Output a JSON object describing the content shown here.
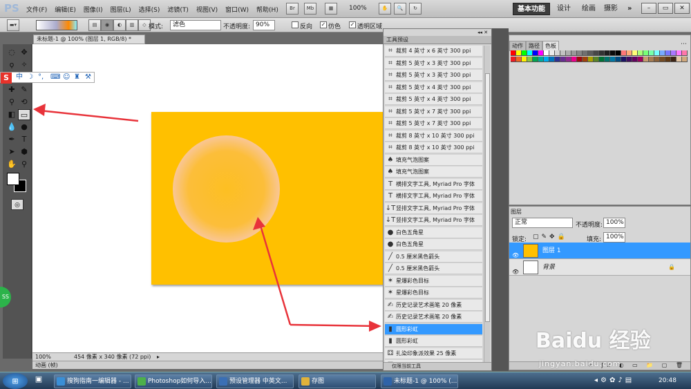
{
  "app": {
    "logo": "PS",
    "doc_tab": "未标题-1 @ 100% (图层 1, RGB/8) *"
  },
  "menus": [
    "文件(F)",
    "编辑(E)",
    "图像(I)",
    "图层(L)",
    "选择(S)",
    "滤镜(T)",
    "视图(V)",
    "窗口(W)",
    "帮助(H)"
  ],
  "toolbar": {
    "btn_br": "Br",
    "btn_mb": "Mb",
    "zoom": "100%"
  },
  "workspaces": [
    "基本功能",
    "设计",
    "绘画",
    "摄影"
  ],
  "window_controls": [
    "–",
    "▭",
    "✕"
  ],
  "options": {
    "mode_label": "模式:",
    "mode_value": "滤色",
    "opacity_label": "不透明度:",
    "opacity_value": "90%",
    "reverse_label": "反向",
    "dither_label": "仿色",
    "transparency_label": "透明区域"
  },
  "status": {
    "zoom": "100%",
    "info": "454 像素 x 340 像素 (72 ppi)",
    "anim_label": "动画 (帧)"
  },
  "ime": {
    "logo": "S",
    "mode": "中"
  },
  "badge": {
    "text": "SS"
  },
  "presets": {
    "title": "工具预设",
    "footer": "仅限当前工具",
    "items": [
      {
        "icon": "crop-icon",
        "label": "裁剪 4 英寸 x 6 英寸 300 ppi"
      },
      {
        "icon": "crop-icon",
        "label": "裁剪 5 英寸 x 3 英寸 300 ppi"
      },
      {
        "icon": "crop-icon",
        "label": "裁剪 5 英寸 x 3 英寸 300 ppi"
      },
      {
        "icon": "crop-icon",
        "label": "裁剪 5 英寸 x 4 英寸 300 ppi"
      },
      {
        "icon": "crop-icon",
        "label": "裁剪 5 英寸 x 4 英寸 300 ppi"
      },
      {
        "icon": "crop-icon",
        "label": "裁剪 5 英寸 x 7 英寸 300 ppi"
      },
      {
        "icon": "crop-icon",
        "label": "裁剪 5 英寸 x 7 英寸 300 ppi"
      },
      {
        "icon": "crop-icon",
        "label": "裁剪 8 英寸 x 10 英寸 300 ppi"
      },
      {
        "icon": "crop-icon",
        "label": "裁剪 8 英寸 x 10 英寸 300 ppi"
      },
      {
        "icon": "bucket-icon",
        "label": "填充气泡图案"
      },
      {
        "icon": "bucket-icon",
        "label": "填充气泡图案"
      },
      {
        "icon": "type-icon",
        "label": "横排文字工具, Myriad Pro 字体"
      },
      {
        "icon": "type-icon",
        "label": "横排文字工具, Myriad Pro 字体"
      },
      {
        "icon": "vtype-icon",
        "label": "竖排文字工具, Myriad Pro 字体"
      },
      {
        "icon": "vtype-icon",
        "label": "竖排文字工具, Myriad Pro 字体"
      },
      {
        "icon": "shape-icon",
        "label": "白色五角星"
      },
      {
        "icon": "shape-icon",
        "label": "白色五角星"
      },
      {
        "icon": "line-icon",
        "label": "0.5 厘米黑色箭头"
      },
      {
        "icon": "line-icon",
        "label": "0.5 厘米黑色箭头"
      },
      {
        "icon": "star-icon",
        "label": "星爆彩色目标"
      },
      {
        "icon": "star-icon",
        "label": "星爆彩色目标"
      },
      {
        "icon": "history-brush-icon",
        "label": "历史记录艺术画笔 20 像素"
      },
      {
        "icon": "history-brush-icon",
        "label": "历史记录艺术画笔 20 像素"
      },
      {
        "icon": "gradient-icon",
        "label": "圆形彩虹",
        "selected": true
      },
      {
        "icon": "gradient-icon",
        "label": "圆形彩虹"
      },
      {
        "icon": "stamp-icon",
        "label": "扎染印象派效果 25 像素"
      },
      {
        "icon": "stamp-icon",
        "label": "扎染印象派效果 25 像素"
      }
    ]
  },
  "swatches": {
    "tabs": [
      "动作",
      "路径",
      "色板"
    ],
    "colors": [
      "#ff0000",
      "#ffff00",
      "#00ff00",
      "#00ffff",
      "#0000ff",
      "#ff00ff",
      "#ffffff",
      "#ebebeb",
      "#d6d6d6",
      "#c2c2c2",
      "#adadad",
      "#999999",
      "#858585",
      "#707070",
      "#5c5c5c",
      "#474747",
      "#333333",
      "#1f1f1f",
      "#0a0a0a",
      "#000000",
      "#ff7777",
      "#ffaa77",
      "#ffff77",
      "#aaff77",
      "#77ff77",
      "#77ffaa",
      "#77ffff",
      "#77aaff",
      "#7777ff",
      "#aa77ff",
      "#ff77ff",
      "#ff77aa",
      "#ed1c24",
      "#f26522",
      "#fff200",
      "#8dc63f",
      "#00a651",
      "#00a99d",
      "#00aeef",
      "#0072bc",
      "#2e3192",
      "#662d91",
      "#92278f",
      "#ec008c",
      "#9e0b0f",
      "#a0410d",
      "#aba000",
      "#598527",
      "#007236",
      "#00746b",
      "#0076a3",
      "#004a80",
      "#1b1464",
      "#440e62",
      "#630460",
      "#9e005d",
      "#c69c6d",
      "#a67c52",
      "#8c6239",
      "#754c24",
      "#603913",
      "#3c2415",
      "#e6c6a3",
      "#d1a97d"
    ],
    "more": "⋯"
  },
  "layers": {
    "title": "图层",
    "blend": "正常",
    "opacity_label": "不透明度:",
    "opacity_value": "100%",
    "lock_label": "锁定:",
    "fill_label": "填充:",
    "fill_value": "100%",
    "items": [
      {
        "name": "图层 1",
        "selected": true
      },
      {
        "name": "背景"
      }
    ]
  },
  "taskbar": {
    "items": [
      {
        "label": "搜狗指南一编辑器 - ..."
      },
      {
        "label": "Photoshop如何导入..."
      },
      {
        "label": "预设管理器 中英文..."
      },
      {
        "label": "存图"
      },
      {
        "label": "未标题-1 @ 100% (..."
      }
    ],
    "clock": "20:48"
  },
  "watermark": {
    "brand": "Baidu 经验",
    "url": "jingyan.baidu.com"
  },
  "colors": {
    "accent": "#3399ff",
    "canvas_orange": "#ffc000",
    "arrow": "#e8333a"
  }
}
